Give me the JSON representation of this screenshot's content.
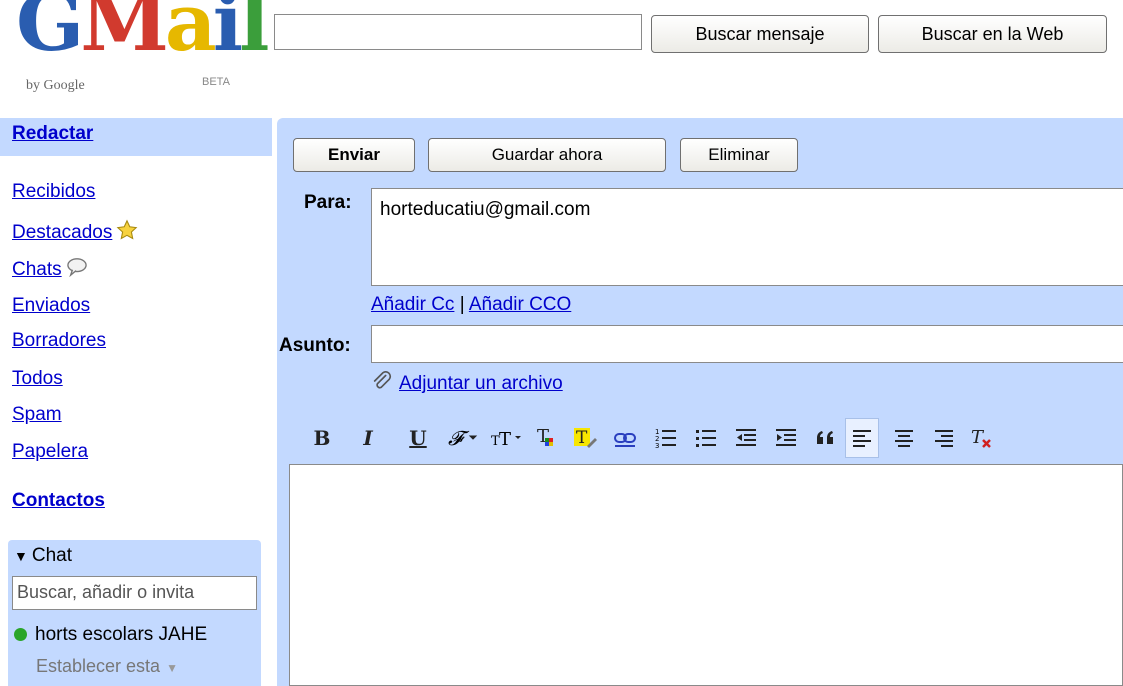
{
  "logo": {
    "wordmark": "Gmail",
    "byline": "by Google",
    "beta": "BETA"
  },
  "search": {
    "query": "",
    "search_mail_label": "Buscar mensaje",
    "search_web_label": "Buscar en la Web"
  },
  "nav": {
    "compose": "Redactar",
    "items": [
      {
        "label": "Recibidos"
      },
      {
        "label": "Destacados",
        "icon": "star-icon"
      },
      {
        "label": "Chats",
        "icon": "chat-bubble-icon"
      },
      {
        "label": "Enviados"
      },
      {
        "label": "Borradores"
      },
      {
        "label": "Todos"
      },
      {
        "label": "Spam"
      },
      {
        "label": "Papelera"
      }
    ],
    "contacts": "Contactos"
  },
  "chat": {
    "header": "Chat",
    "search_value": "Buscar, añadir o invita",
    "contact_name": "horts escolars JAHE",
    "status": "Establecer esta",
    "status_color": "#2aa52a"
  },
  "compose": {
    "send_label": "Enviar",
    "save_label": "Guardar ahora",
    "delete_label": "Eliminar",
    "to_label": "Para:",
    "to_value": "horteducatiu@gmail.com",
    "add_cc": "Añadir Cc",
    "separator": "|",
    "add_bcc": "Añadir CCO",
    "subject_label": "Asunto:",
    "subject_value": "",
    "attach_label": "Adjuntar un archivo",
    "body": ""
  },
  "toolbar": {
    "items": [
      "bold-icon",
      "italic-icon",
      "underline-icon",
      "font-icon",
      "text-size-icon",
      "text-color-icon",
      "highlight-icon",
      "link-icon",
      "numbered-list-icon",
      "bulleted-list-icon",
      "indent-less-icon",
      "indent-more-icon",
      "quote-icon",
      "align-left-icon",
      "align-center-icon",
      "align-right-icon",
      "remove-formatting-icon"
    ],
    "bold_glyph": "B",
    "italic_glyph": "I",
    "underline_glyph": "U"
  },
  "colors": {
    "accent": "#c3d9ff",
    "link": "#0000cc"
  }
}
